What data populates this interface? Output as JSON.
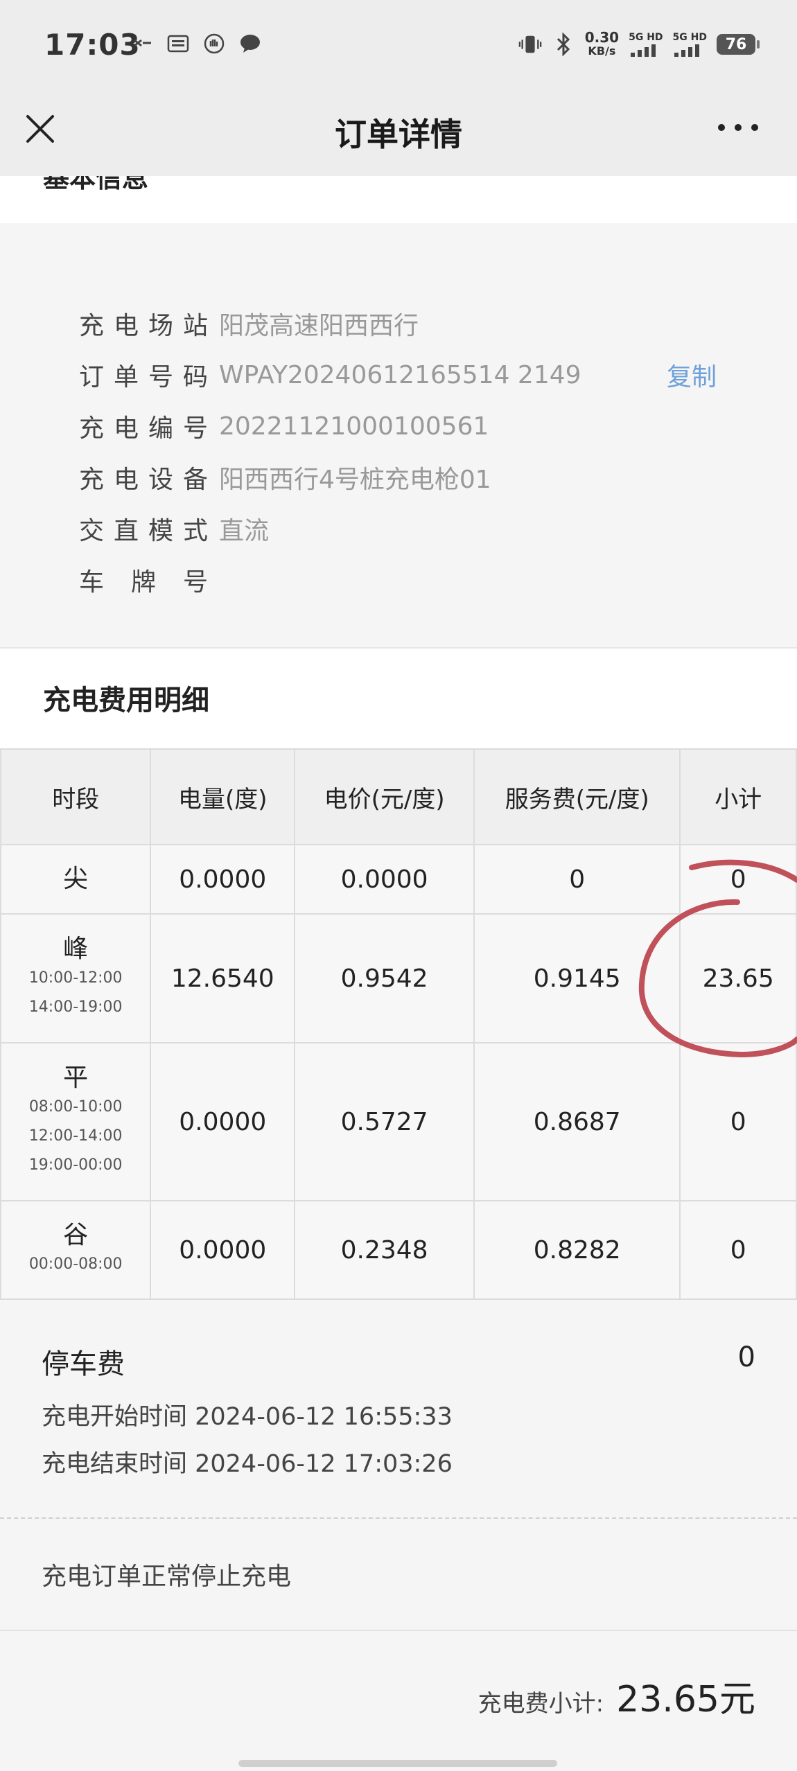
{
  "status_bar": {
    "time": "17:03",
    "net_speed_value": "0.30",
    "net_speed_unit": "KB/s",
    "sim1_label": "5G HD",
    "sim2_label": "5G HD",
    "battery": "76"
  },
  "nav": {
    "title": "订单详情"
  },
  "basic_info": {
    "section_title": "基本信息",
    "rows": [
      {
        "label": "充电场站",
        "value": "阳茂高速阳西西行"
      },
      {
        "label": "订单号码",
        "value": "WPAY20240612165514 2149"
      },
      {
        "label": "充电编号",
        "value": "20221121000100561"
      },
      {
        "label": "充电设备",
        "value": "阳西西行4号桩充电枪01"
      },
      {
        "label": "交直模式",
        "value": "直流"
      },
      {
        "label": "车牌号",
        "value": ""
      }
    ],
    "copy_label": "复制"
  },
  "fee_detail": {
    "title": "充电费用明细",
    "headers": [
      "时段",
      "电量(度)",
      "电价(元/度)",
      "服务费(元/度)",
      "小计"
    ],
    "rows": [
      {
        "period": "尖",
        "times": [],
        "kwh": "0.0000",
        "price": "0.0000",
        "service": "0",
        "subtotal": "0"
      },
      {
        "period": "峰",
        "times": [
          "10:00-12:00",
          "14:00-19:00"
        ],
        "kwh": "12.6540",
        "price": "0.9542",
        "service": "0.9145",
        "subtotal": "23.65"
      },
      {
        "period": "平",
        "times": [
          "08:00-10:00",
          "12:00-14:00",
          "19:00-00:00"
        ],
        "kwh": "0.0000",
        "price": "0.5727",
        "service": "0.8687",
        "subtotal": "0"
      },
      {
        "period": "谷",
        "times": [
          "00:00-08:00"
        ],
        "kwh": "0.0000",
        "price": "0.2348",
        "service": "0.8282",
        "subtotal": "0"
      }
    ]
  },
  "parking": {
    "label": "停车费",
    "value": "0",
    "start_time": "充电开始时间 2024-06-12 16:55:33",
    "end_time": "充电结束时间 2024-06-12 17:03:26"
  },
  "stop_reason": "充电订单正常停止充电",
  "subtotal": {
    "label": "充电费小计:",
    "value": "23.65元"
  },
  "colors": {
    "copy_link": "#6ea0d9",
    "annotation": "#c0505a"
  }
}
